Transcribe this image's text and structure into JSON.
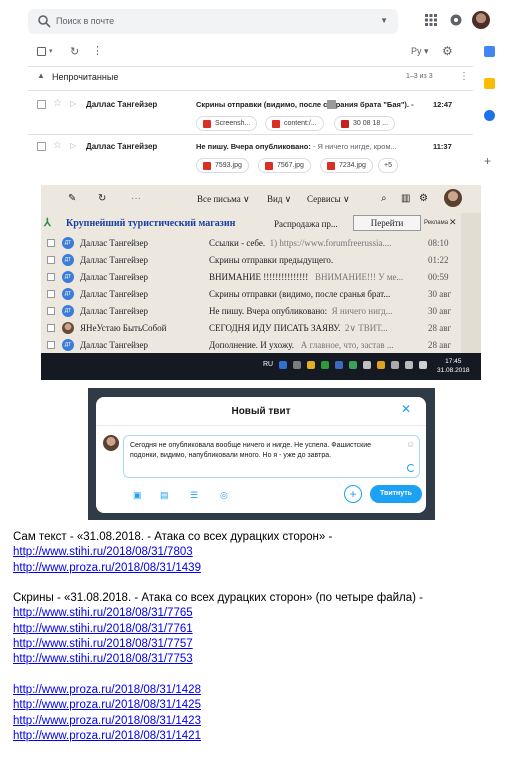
{
  "gmail": {
    "search_placeholder": "Поиск в почте",
    "lang": "Ру ▾",
    "section_title": "Непрочитанные",
    "section_count": "1–3 из 3",
    "rows": [
      {
        "from": "Даллас Тангейзер",
        "subject": "Скрины отправки (видимо, после с",
        "subject_rest": "рания брата \"Бая\"). -",
        "time": "12:47",
        "attachments": [
          "Screensh...",
          "content:/...",
          "30 08 18 ..."
        ]
      },
      {
        "from": "Даллас Тангейзер",
        "subject": "Не пишу. Вчера опубликовано:",
        "snippet": " - Я ничего нигде, кром...",
        "time": "11:37",
        "attachments": [
          "7593.jpg",
          "7567.jpg",
          "7234.jpg",
          "+5"
        ]
      }
    ],
    "colors": {
      "attachment": "#d93025"
    }
  },
  "mailru": {
    "menu": {
      "all_letters": "Все письма ∨",
      "view": "Вид ∨",
      "services": "Сервисы ∨"
    },
    "ad": {
      "title": "Крупнейший туристический магазин",
      "text": "Распродажа пр...",
      "button": "Перейти",
      "badge": "Реклама"
    },
    "rows": [
      {
        "avatar": "ДТ",
        "from": "Даллас Тангейзер",
        "subject": "Ссылки - себе.",
        "snippet": "1) https://www.forumfreerussia....",
        "date": "08:10"
      },
      {
        "avatar": "ДТ",
        "from": "Даллас Тангейзер",
        "subject": "Скрины отправки предыдущего.",
        "snippet": "",
        "date": "01:22"
      },
      {
        "avatar": "ДТ",
        "from": "Даллас Тангейзер",
        "subject": "ВНИМАНИЕ !!!!!!!!!!!!!!!",
        "snippet": "ВНИМАНИЕ!!! У ме...",
        "date": "00:59"
      },
      {
        "avatar": "ДТ",
        "from": "Даллас Тангейзер",
        "subject": "Скрины отправки (видимо, после сранья брат...",
        "snippet": "",
        "date": "30 авг"
      },
      {
        "avatar": "ДТ",
        "from": "Даллас Тангейзер",
        "subject": "Не пишу. Вчера опубликовано:",
        "snippet": "Я ничего нигд...",
        "date": "30 авг"
      },
      {
        "avatar": "",
        "from": "ЯНеУстаю БытьСобой",
        "subject": "СЕГОДНЯ ИДУ ПИСАТЬ ЗАЯВУ.",
        "snippet": "2∨ ТВИТ...",
        "date": "28 авг"
      },
      {
        "avatar": "ДТ",
        "from": "Даллас Тангейзер",
        "subject": "Дополнение. И ухожу.",
        "snippet": "А главное, что, застав ...",
        "date": "28 авг"
      }
    ],
    "taskbar": {
      "lang": "RU",
      "time": "17:45",
      "date": "31.08.2018"
    }
  },
  "twitter": {
    "title": "Новый твит",
    "text": "Сегодня не опубликовала вообще ничего и нигде. Не успела. Фашистские подонки, видимо, напубликовали много. Но я - уже до завтра.",
    "button": "Твитнуть"
  },
  "body": {
    "line1": "Сам текст - «31.08.2018.  - Атака со всех дурацких сторон» -",
    "links1": [
      "http://www.stihi.ru/2018/08/31/7803",
      "http://www.proza.ru/2018/08/31/1439"
    ],
    "line2": "Скрины - «31.08.2018.  - Атака со всех дурацких сторон» (по четыре файла) -",
    "links2": [
      "http://www.stihi.ru/2018/08/31/7765",
      "http://www.stihi.ru/2018/08/31/7761",
      "http://www.stihi.ru/2018/08/31/7757",
      "http://www.stihi.ru/2018/08/31/7753"
    ],
    "links3": [
      "http://www.proza.ru/2018/08/31/1428",
      "http://www.proza.ru/2018/08/31/1425",
      "http://www.proza.ru/2018/08/31/1423",
      "http://www.proza.ru/2018/08/31/1421"
    ]
  }
}
